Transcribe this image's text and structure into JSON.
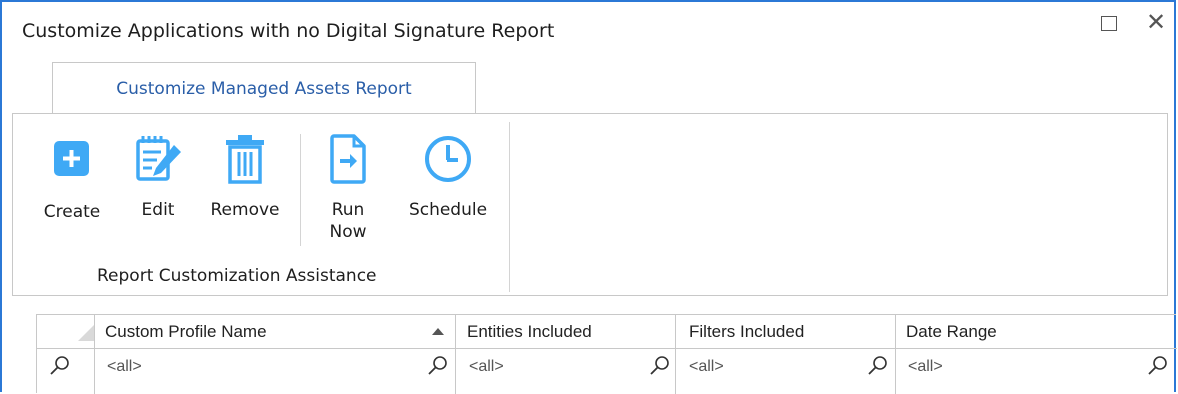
{
  "window": {
    "title": "Customize Applications with no Digital Signature Report"
  },
  "ribbon": {
    "tab_label": "Customize Managed Assets Report",
    "buttons": {
      "create": "Create",
      "edit": "Edit",
      "remove": "Remove",
      "run_now_line1": "Run",
      "run_now_line2": "Now",
      "schedule": "Schedule"
    },
    "group_label": "Report Customization Assistance",
    "icon_color": "#3fa9f5"
  },
  "grid": {
    "columns": [
      "Custom Profile Name",
      "Entities Included",
      "Filters Included",
      "Date Range"
    ],
    "sorted_column": "Custom Profile Name",
    "sort_direction": "ascending",
    "filters": [
      "<all>",
      "<all>",
      "<all>",
      "<all>"
    ]
  }
}
